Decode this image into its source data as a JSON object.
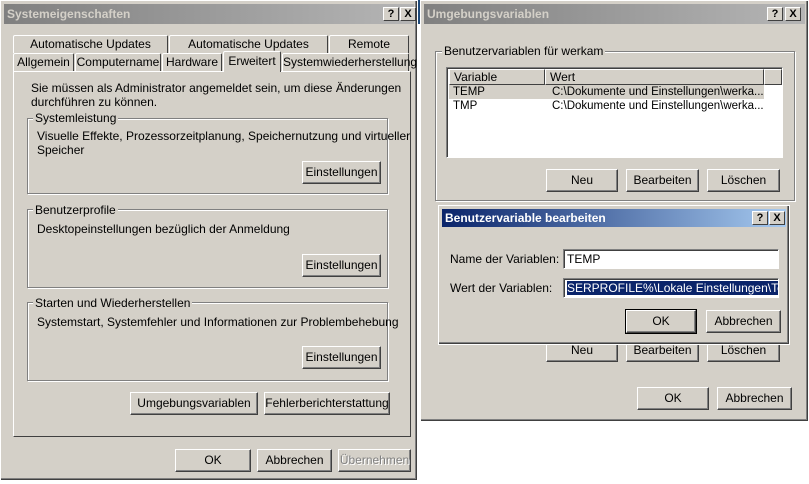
{
  "system_props": {
    "title": "Systemeigenschaften",
    "help_btn": "?",
    "close_btn": "X",
    "tabs_top": [
      "Automatische Updates",
      "Automatische Updates",
      "Remote"
    ],
    "tabs_bottom": [
      "Allgemein",
      "Computername",
      "Hardware",
      "Erweitert",
      "Systemwiederherstellung"
    ],
    "admin_note_line1": "Sie müssen als Administrator angemeldet sein, um diese Änderungen",
    "admin_note_line2": "durchführen zu können.",
    "performance": {
      "label": "Systemleistung",
      "text_line1": "Visuelle Effekte, Prozessorzeitplanung, Speichernutzung und virtueller",
      "text_line2": "Speicher",
      "button": "Einstellungen"
    },
    "profiles": {
      "label": "Benutzerprofile",
      "text": "Desktopeinstellungen bezüglich der Anmeldung",
      "button": "Einstellungen"
    },
    "startup": {
      "label": "Starten und Wiederherstellen",
      "text": "Systemstart, Systemfehler und Informationen zur Problembehebung",
      "button": "Einstellungen"
    },
    "env_button": "Umgebungsvariablen",
    "error_report_button": "Fehlerberichterstattung",
    "ok": "OK",
    "cancel": "Abbrechen",
    "apply": "Übernehmen"
  },
  "env_vars": {
    "title": "Umgebungsvariablen",
    "help_btn": "?",
    "close_btn": "X",
    "user_group_label": "Benutzervariablen für werkam",
    "columns": [
      "Variable",
      "Wert"
    ],
    "rows": [
      {
        "name": "TEMP",
        "value": "C:\\Dokumente und Einstellungen\\werka..."
      },
      {
        "name": "TMP",
        "value": "C:\\Dokumente und Einstellungen\\werka..."
      }
    ],
    "new": "Neu",
    "edit": "Bearbeiten",
    "delete": "Löschen",
    "new2": "Neu",
    "edit2": "Bearbeiten",
    "delete2": "Löschen",
    "ok": "OK",
    "cancel": "Abbrechen"
  },
  "edit_var": {
    "title": "Benutzervariable bearbeiten",
    "help_btn": "?",
    "close_btn": "X",
    "name_label": "Name der Variablen:",
    "name_value": "TEMP",
    "value_label": "Wert der Variablen:",
    "value_value": "SERPROFILE%\\Lokale Einstellungen\\Temp",
    "ok": "OK",
    "cancel": "Abbrechen"
  }
}
